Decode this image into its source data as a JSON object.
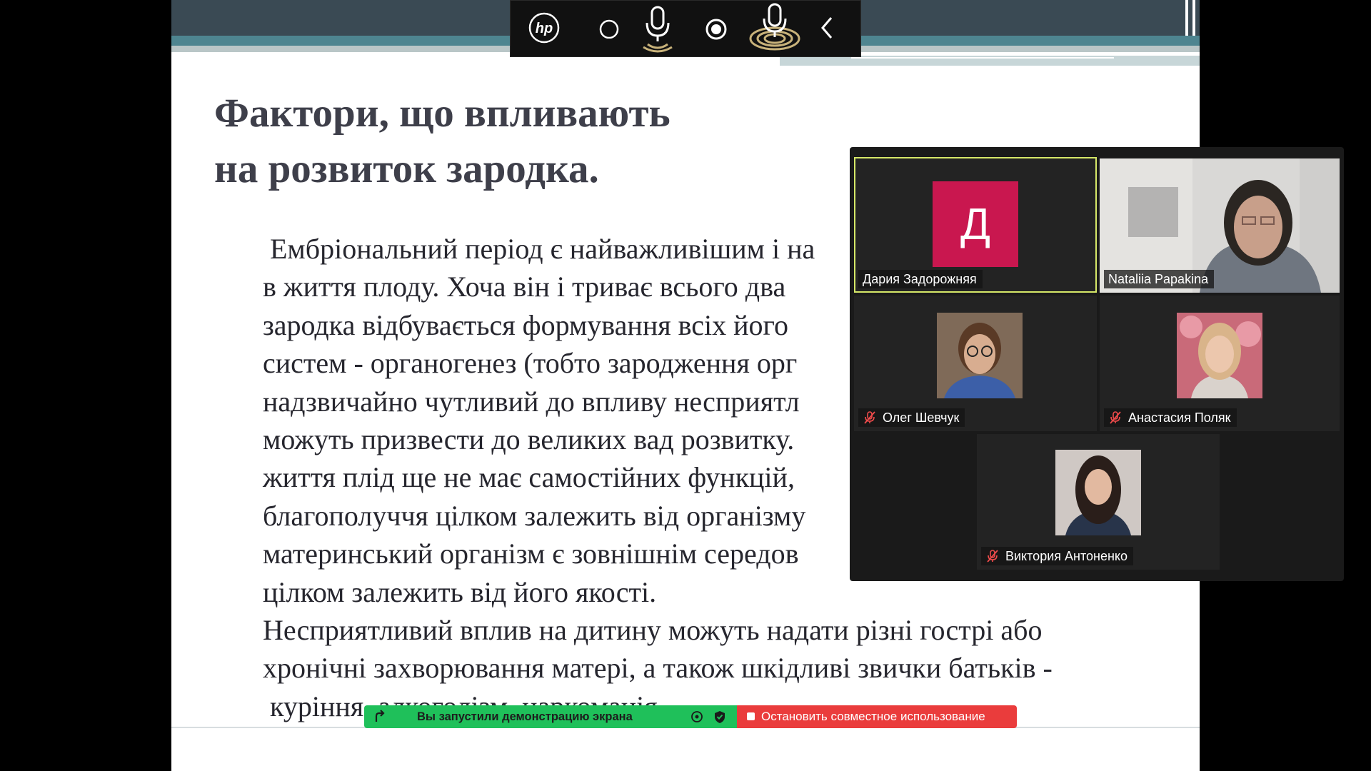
{
  "slide": {
    "title": "Фактори, що впливають\nна розвиток зародка.",
    "body_lines": [
      " Ембріональний період є найважливішим і на",
      "в життя плоду. Хоча він і триває всього два",
      "зародка відбувається формування всіх його",
      "систем - органогенез (тобто зародження орг",
      "надзвичайно чутливий до впливу несприятл",
      "можуть призвести до великих вад розвитку.",
      "життя плід ще не має самостійних функцій,",
      "благополуччя цілком залежить від організму",
      "материнський організм є зовнішнім середов",
      "цілком залежить від його якості.",
      "Несприятливий вплив на дитину можуть надати різні гострі або",
      "хронічні захворювання матері, а також шкідливі звички батьків -",
      " куріння, алкоголізм, наркоманія."
    ]
  },
  "toolbar": {
    "icons": [
      "hp-logo-icon",
      "circle-icon",
      "microphone-icon",
      "record-dot-icon",
      "microphone-active-icon",
      "chevron-left-icon"
    ]
  },
  "gallery": {
    "participants": [
      {
        "name": "Дария Задорожняя",
        "initial": "Д",
        "avatar_color": "#c9174f",
        "muted": false,
        "active_speaker": true
      },
      {
        "name": "Nataliia Papakina",
        "muted": false,
        "active_speaker": false
      },
      {
        "name": "Олег Шевчук",
        "muted": true,
        "active_speaker": false
      },
      {
        "name": "Анастасия Поляк",
        "muted": true,
        "active_speaker": false
      },
      {
        "name": "Виктория Антоненко",
        "muted": true,
        "active_speaker": false
      }
    ]
  },
  "share_bar": {
    "status_text": "Вы запустили демонстрацию экрана",
    "stop_label": "Остановить совместное использование",
    "colors": {
      "green": "#1fc05a",
      "red": "#ea3c3c"
    }
  }
}
